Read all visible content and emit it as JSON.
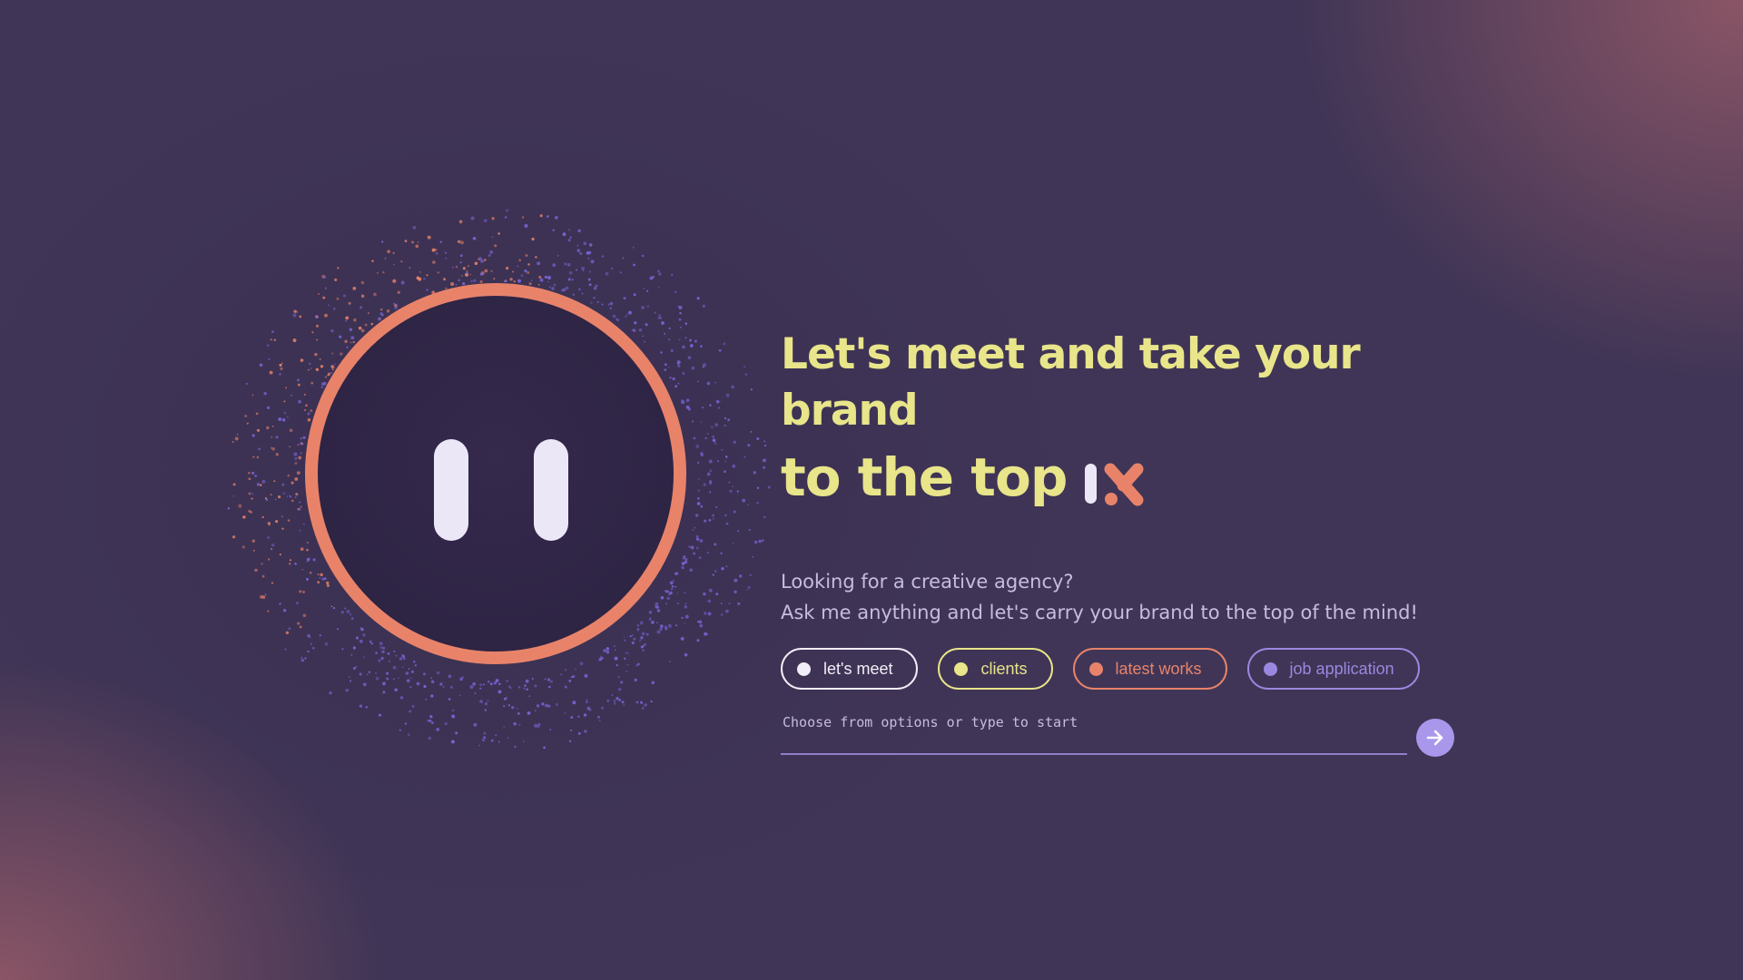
{
  "headline": {
    "line1": "Let's meet and take your brand",
    "line2": "to the top"
  },
  "subtitle": {
    "line1": "Looking for a creative agency?",
    "line2": "Ask me anything and let's carry your brand to the top of the mind!"
  },
  "chips": [
    {
      "label": "let's meet",
      "color": "#f2eef8"
    },
    {
      "label": "clients",
      "color": "#e8e58a"
    },
    {
      "label": "latest works",
      "color": "#e8836a"
    },
    {
      "label": "job application",
      "color": "#9a88e0"
    }
  ],
  "chat_input": {
    "placeholder": "Choose from options or type to start",
    "value": ""
  },
  "send_button": {
    "icon": "arrow-right-icon",
    "color": "#a997ec"
  },
  "colors": {
    "background": "#403556",
    "accent_yellow": "#e8e58a",
    "accent_orange": "#e8836a",
    "accent_purple": "#9a88e0",
    "face_bg": "#2e2444",
    "eyes": "#ece7f7"
  },
  "icons": {
    "logo_mark": "brand-logo-icon",
    "mascot": "mascot-face-icon"
  }
}
